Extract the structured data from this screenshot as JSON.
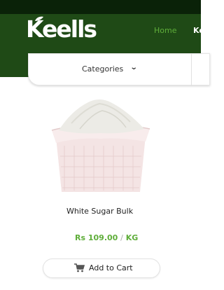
{
  "brand": {
    "logo_text": "Keells"
  },
  "nav": {
    "home_label": "Home",
    "next_label": "Ke"
  },
  "categories": {
    "label": "Categories",
    "chevron_icon": "chevron-down-icon"
  },
  "product": {
    "name": "White Sugar Bulk",
    "price_currency": "Rs",
    "price_value": "109.00",
    "price_separator": "/",
    "price_unit": "KG",
    "add_to_cart_label": "Add to Cart",
    "cart_icon": "shopping-cart-icon"
  },
  "colors": {
    "topbar": "#0a2208",
    "header": "#1f4a16",
    "accent_green": "#5fae3a",
    "text": "#222222"
  }
}
